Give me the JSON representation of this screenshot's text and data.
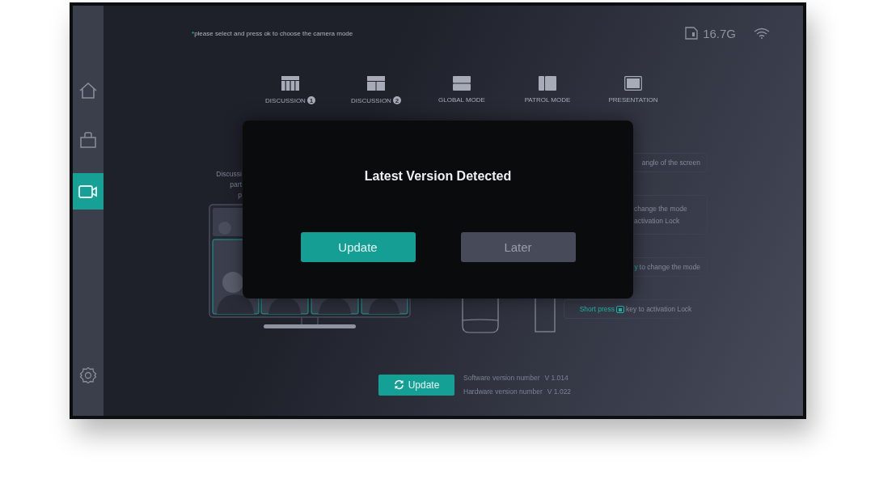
{
  "sidebar": {
    "items": [
      {
        "kind": "home",
        "selected": false
      },
      {
        "kind": "bag",
        "selected": false
      },
      {
        "kind": "camera",
        "selected": true
      }
    ],
    "footer": {
      "kind": "gear"
    }
  },
  "hint": {
    "mark": "*",
    "text": "please select and press ok to choose the camera mode"
  },
  "status": {
    "storage": "16.7G"
  },
  "modes": [
    {
      "kind": "columns",
      "label": "DISCUSSION",
      "badge": "1"
    },
    {
      "kind": "split",
      "label": "DISCUSSION",
      "badge": "2"
    },
    {
      "kind": "rows",
      "label": "GLOBAL MODE"
    },
    {
      "kind": "halves",
      "label": "PATROL MODE"
    },
    {
      "kind": "single",
      "label": "PRESENTATION"
    }
  ],
  "description": [
    "Discussi",
    "part",
    "p"
  ],
  "cards": [
    {
      "lines": [
        "angle of the screen"
      ],
      "kind": "right"
    },
    {
      "lines": [
        "change the mode",
        "activation Lock"
      ],
      "kind": "left"
    },
    {
      "highlight": "y",
      "text": " to change the mode",
      "kind": "right"
    },
    {
      "highlight": "Short press",
      "text": "key to activation Lock",
      "kind": "center",
      "icon": true
    }
  ],
  "update_button": "Update",
  "versions": [
    {
      "label": "Software version number",
      "value": "V 1.014"
    },
    {
      "label": "Hardware version number",
      "value": "V 1.022"
    }
  ],
  "dialog": {
    "title": "Latest Version Detected",
    "buttons": [
      {
        "label": "Update",
        "kind": "primary"
      },
      {
        "label": "Later",
        "kind": "secondary"
      }
    ]
  }
}
